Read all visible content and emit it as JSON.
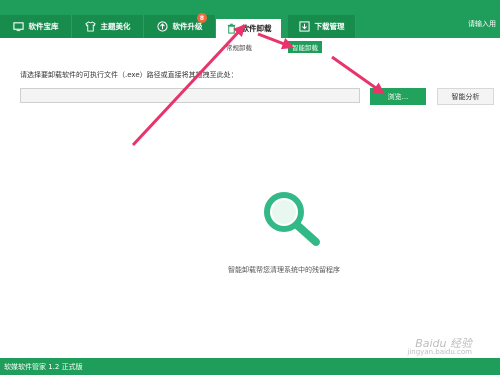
{
  "tabs": [
    {
      "label": "软件宝库",
      "icon": "monitor-icon"
    },
    {
      "label": "主题美化",
      "icon": "shirt-icon"
    },
    {
      "label": "软件升级",
      "icon": "upgrade-icon",
      "badge": "8"
    },
    {
      "label": "软件卸载",
      "icon": "trash-icon"
    },
    {
      "label": "下载管理",
      "icon": "download-icon"
    }
  ],
  "login_label": "请输入用",
  "subtabs": {
    "normal": "常规卸载",
    "smart": "智能卸载"
  },
  "prompt": "请选择要卸载软件的可执行文件（.exe）路径或直接将其拖拽至此处：",
  "path_value": "",
  "browse_label": "浏览...",
  "analyze_label": "智能分析",
  "hint": "智能卸载帮您清理系统中的残留程序",
  "version": "软媒软件管家 1.2 正式版",
  "watermark": "Baidu 经验",
  "watermark_url": "jingyan.baidu.com",
  "colors": {
    "brand_green": "#1e9e5a",
    "arrow": "#e8336b"
  }
}
